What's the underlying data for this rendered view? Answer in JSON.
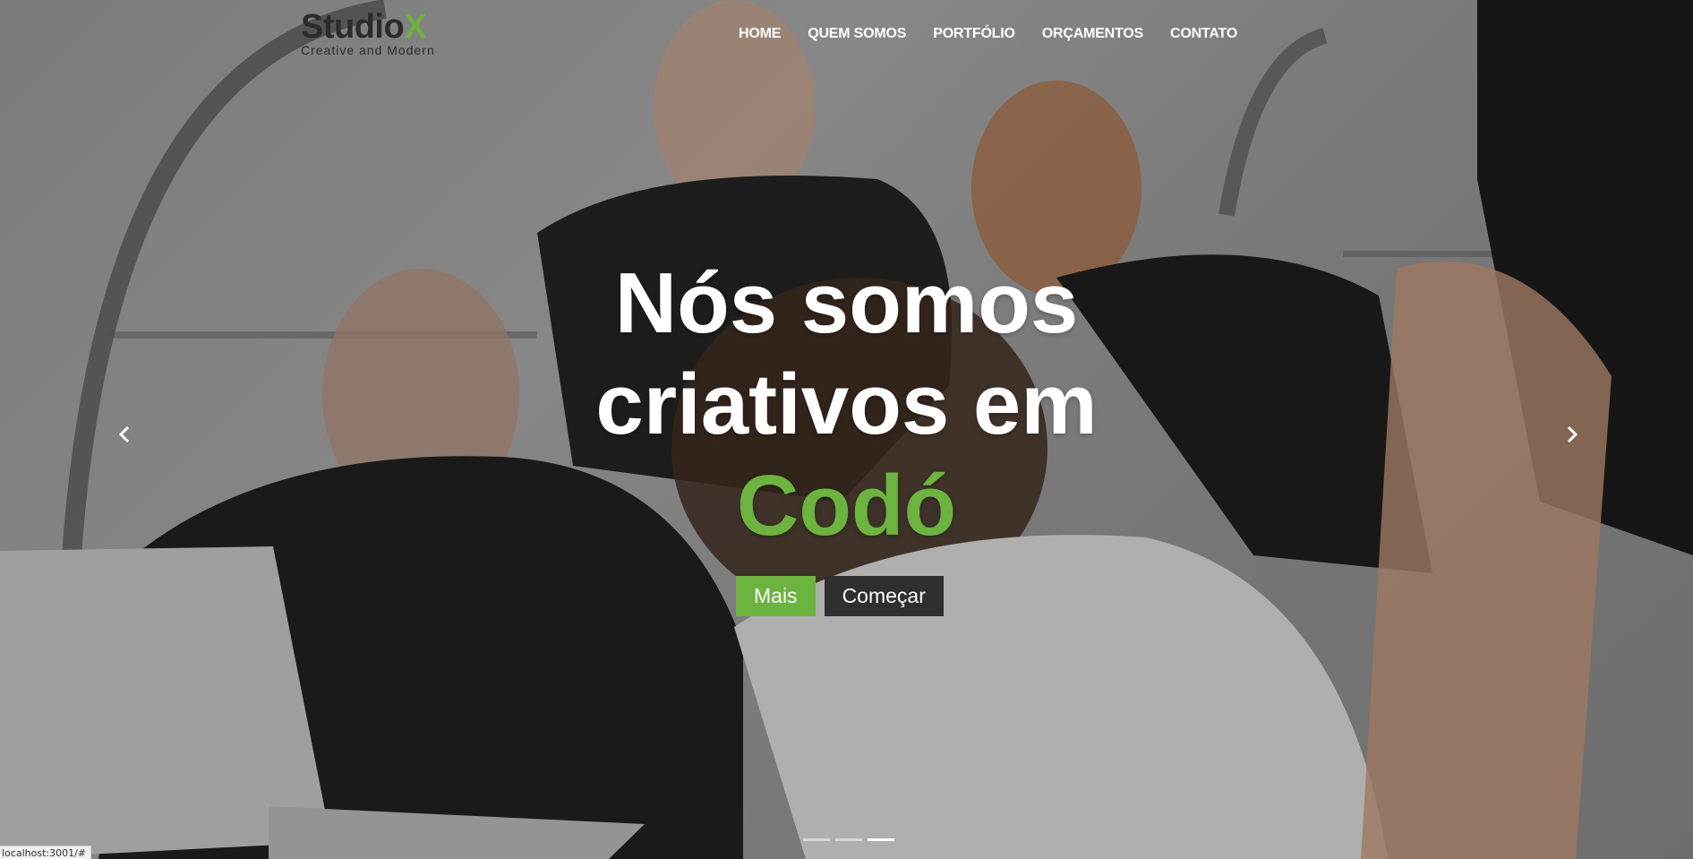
{
  "brand": {
    "name_main": "Studio",
    "name_x": "X",
    "tagline": "Creative and Modern"
  },
  "nav": {
    "items": [
      {
        "label": "HOME"
      },
      {
        "label": "QUEM SOMOS"
      },
      {
        "label": "PORTFÓLIO"
      },
      {
        "label": "ORÇAMENTOS"
      },
      {
        "label": "CONTATO"
      }
    ]
  },
  "hero": {
    "line1": "Nós somos",
    "line2": "criativos em",
    "line3": "Codó",
    "primary_button": "Mais",
    "secondary_button": "Começar",
    "prev_icon": "chevron-left-icon",
    "next_icon": "chevron-right-icon",
    "active_slide": 3,
    "slide_count": 3
  },
  "status_bar": {
    "url": "localhost:3001/#"
  },
  "colors": {
    "accent": "#6db33f",
    "dark_button": "#2f2f2f",
    "nav_text": "#ffffff"
  }
}
